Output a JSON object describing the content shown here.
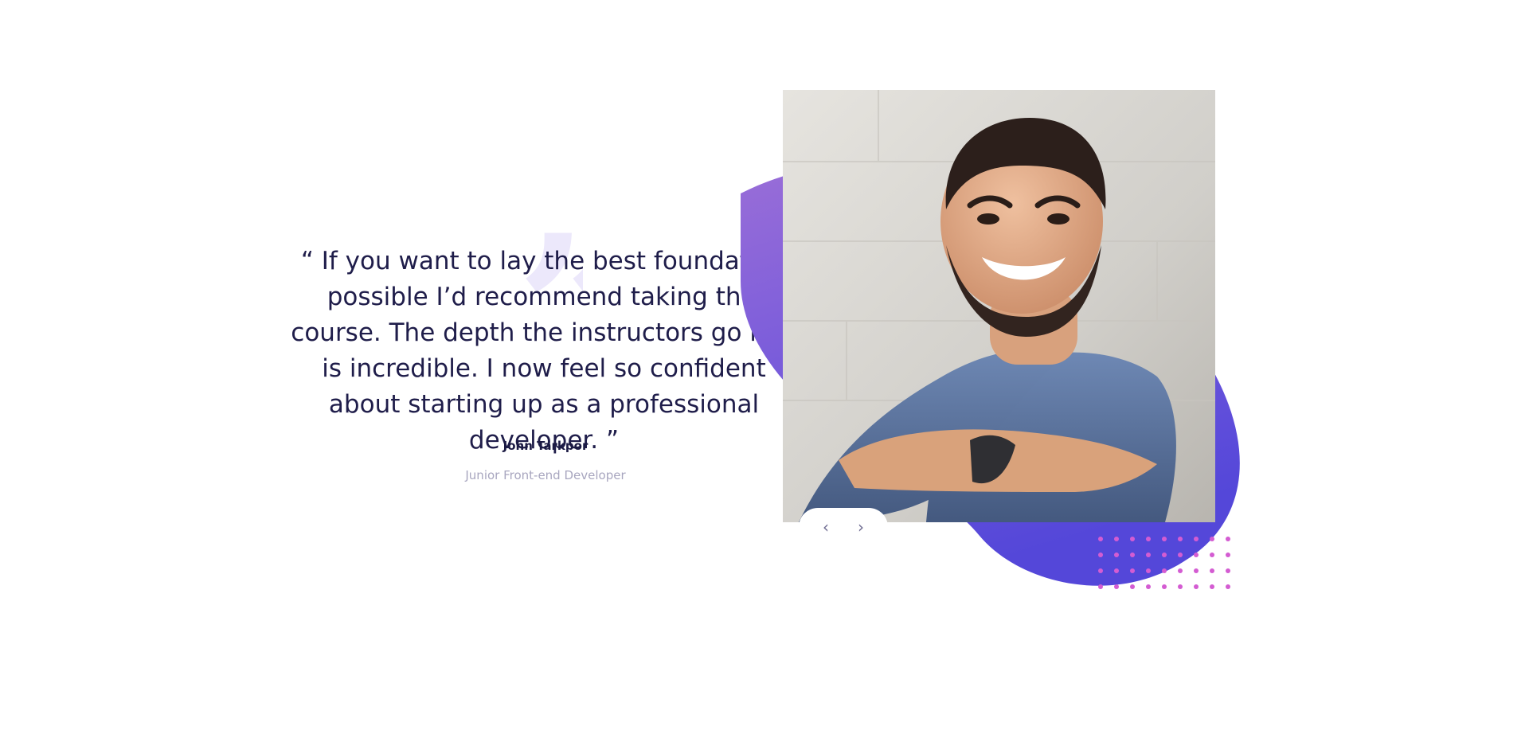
{
  "testimonial": {
    "quote_mark": "”",
    "quote": "“ If you want to lay the best foundation possible I’d recommend taking this course. The depth the instructors go into is incredible. I now feel so confident about starting up as a professional developer. ”",
    "author_name": "John Tarkpor",
    "author_role": "Junior Front-end Developer"
  },
  "navigation": {
    "prev_label": "‹",
    "next_label": "›"
  },
  "colors": {
    "text_primary": "#1f1d4a",
    "text_secondary": "#a8a6bf",
    "blob_top": "#8f67d8",
    "blob_bottom": "#5b4bd8",
    "dots": "#d45cd2"
  }
}
